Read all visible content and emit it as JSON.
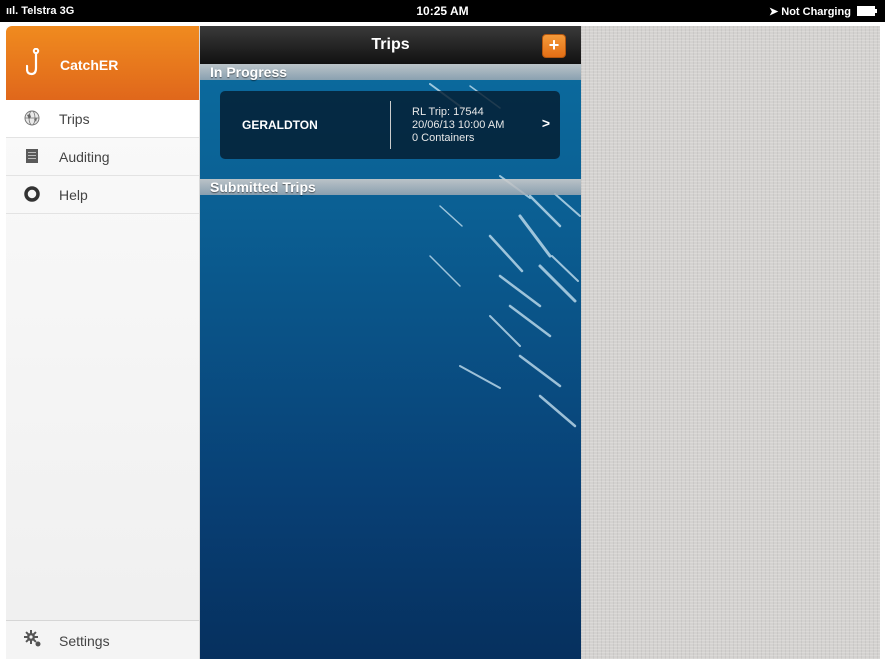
{
  "status_bar": {
    "carrier": "Telstra",
    "network": "3G",
    "time": "10:25 AM",
    "charging": "Not Charging"
  },
  "sidebar": {
    "app_name": "CatchER",
    "items": [
      {
        "label": "Trips",
        "icon": "globe-icon",
        "active": true
      },
      {
        "label": "Auditing",
        "icon": "document-icon",
        "active": false
      },
      {
        "label": "Help",
        "icon": "lifebuoy-icon",
        "active": false
      }
    ],
    "settings_label": "Settings"
  },
  "trips": {
    "title": "Trips",
    "add_label": "+",
    "sections": {
      "in_progress": "In Progress",
      "submitted": "Submitted Trips"
    },
    "trip": {
      "port": "GERALDTON",
      "trip_number": "RL Trip: 17544",
      "datetime": "20/06/13 10:00 AM",
      "containers": "0 Containers"
    }
  },
  "colors": {
    "brand_orange": "#e8771c",
    "ocean_blue": "#0b5f93",
    "linen": "#d4d2d0"
  }
}
